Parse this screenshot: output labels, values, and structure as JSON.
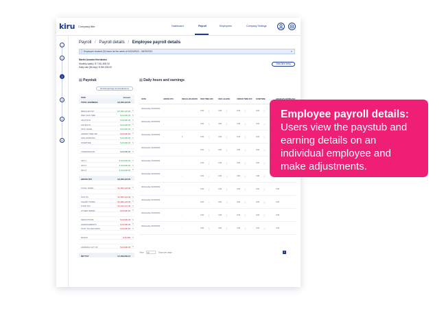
{
  "app": {
    "logo": "kiru",
    "company": "Company title"
  },
  "nav": {
    "items": [
      "Dashboard",
      "Payroll",
      "Employees",
      "Company Settings"
    ]
  },
  "header_icons": [
    "user-icon",
    "settings-icon"
  ],
  "steps": [
    "‹",
    "1",
    "2",
    "3",
    "4",
    "5"
  ],
  "breadcrumb": {
    "a": "Payroll",
    "b": "Payroll details",
    "current": "Employee payroll details",
    "sep": "/"
  },
  "alert": {
    "text": "Employee clocked (9) hours for the week of 04/24/2022 - 04/23/2021",
    "close": "×"
  },
  "employee": {
    "name": "Martin Amador Hernández",
    "salary": "Monthly salary: $ 7,511,600.00",
    "rate": "Daily rate (8h day): $ 250,000.00"
  },
  "view_button": "View time entry",
  "paystub": {
    "title": "Paystub",
    "add_button": "⊕ Add earnings and deductions",
    "header": {
      "item": "ITEM",
      "amount": "Amount"
    },
    "rows": [
      {
        "l": "TOTAL EARNINGS",
        "v": "$ 6,350,124.00",
        "t": "total",
        "c": ""
      },
      {
        "l": "",
        "v": "",
        "t": "",
        "c": ""
      },
      {
        "l": "REGULAR PAY",
        "v": "$ 4,960,124.00",
        "t": "",
        "c": "g"
      },
      {
        "l": "PAID SICK TIME",
        "v": "$ 20,000.00",
        "t": "",
        "c": "g"
      },
      {
        "l": "VACATION",
        "v": "$ 20,000.00",
        "t": "",
        "c": "g"
      },
      {
        "l": "HOLIDAYS",
        "v": "$ 20,000.00",
        "t": "",
        "c": "g"
      },
      {
        "l": "SICK LEAVE",
        "v": "$ 20,000.00",
        "t": "",
        "c": "g"
      },
      {
        "l": "UNPAID TIME OFF",
        "v": "$ 20,000.00",
        "t": "",
        "c": "r"
      },
      {
        "l": "NON-WORKING",
        "v": "$ 20,000.00",
        "t": "",
        "c": "g"
      },
      {
        "l": "OVERTIME",
        "v": "$ 20,000.00",
        "t": "",
        "c": "g"
      },
      {
        "l": "",
        "v": "",
        "t": "",
        "c": ""
      },
      {
        "l": "COMMISSIONS",
        "v": "$ 20,000.00",
        "t": "",
        "c": ""
      },
      {
        "l": "",
        "v": "",
        "t": "",
        "c": ""
      },
      {
        "l": "SKU 1",
        "v": "$ 100,000.00",
        "t": "",
        "c": "g"
      },
      {
        "l": "SKU 2",
        "v": "$ 100,000.00",
        "t": "",
        "c": "g"
      },
      {
        "l": "SKU 3",
        "v": "$ 100,000.00",
        "t": "",
        "c": "g"
      },
      {
        "l": "",
        "v": "",
        "t": "",
        "c": ""
      },
      {
        "l": "GROSS PAY",
        "v": "$ 6,350,124.00",
        "t": "total",
        "c": ""
      },
      {
        "l": "",
        "v": "",
        "t": "",
        "c": ""
      },
      {
        "l": "TOTAL TAXES",
        "v": "$ 1,660,124.00",
        "t": "",
        "c": "r"
      },
      {
        "l": "",
        "v": "",
        "t": "",
        "c": ""
      },
      {
        "l": "FICA SS",
        "v": "$ 4,960,124.00",
        "t": "",
        "c": "r"
      },
      {
        "l": "SALARY TAXES",
        "v": "$ 4,960,124.00",
        "t": "",
        "c": "r"
      },
      {
        "l": "FUND TAX",
        "v": "$ 3,613,137.00",
        "t": "",
        "c": "r"
      },
      {
        "l": "OTHER TERMS",
        "v": "$ 20,000.00",
        "t": "",
        "c": "r"
      },
      {
        "l": "",
        "v": "",
        "t": "",
        "c": ""
      },
      {
        "l": "DEDUCTIONS",
        "v": "$ 20,000.00",
        "t": "",
        "c": "r"
      },
      {
        "l": "GARNISHMENTS",
        "v": "$ 20,000.00",
        "t": "",
        "c": "r"
      },
      {
        "l": "POST TAX RETURNS",
        "v": "$ 20,000.00",
        "t": "",
        "c": "r"
      },
      {
        "l": "",
        "v": "",
        "t": "",
        "c": ""
      },
      {
        "l": "BANUS",
        "v": "$ 20,000",
        "t": "",
        "c": "r"
      },
      {
        "l": "",
        "v": "",
        "t": "",
        "c": ""
      },
      {
        "l": "ADVANCE CUT OF",
        "v": "$ 20,000.00",
        "t": "",
        "c": "r"
      },
      {
        "l": "",
        "v": "",
        "t": "",
        "c": ""
      },
      {
        "l": "NET PAY",
        "v": "$ 4,639,262.13",
        "t": "total",
        "c": ""
      }
    ]
  },
  "daily": {
    "title": "Daily hours and earnings",
    "columns": [
      "DATE",
      "GROSS PAY",
      "REGULAR HOURS",
      "PAID TIME OFF",
      "SICK LEAVES",
      "UNPAID TIME OFF",
      "OVERTIME",
      "HOLIDAYS EXTRA PAY"
    ],
    "rows": [
      {
        "date": "Wednesday 04/06/2021",
        "gross": "-",
        "reg": "-",
        "pto": "0.00",
        "sick": "0.00",
        "unpaid": "0.00",
        "ot": "0.00",
        "hol": ""
      },
      {
        "date": "Wednesday 04/06/2021",
        "gross": "-",
        "reg": "-",
        "pto": "0.00",
        "sick": "0.00",
        "unpaid": "0.00",
        "ot": "0.00",
        "hol": ""
      },
      {
        "date": "Wednesday 04/06/2021",
        "gross": "-",
        "reg": "1",
        "pto": "0.00",
        "sick": "0.00",
        "unpaid": "0.00",
        "ot": "0.00",
        "hol": ""
      },
      {
        "date": "Wednesday 04/06/2021",
        "gross": "-",
        "reg": "-",
        "pto": "0.00",
        "sick": "0.00",
        "unpaid": "0.00",
        "ot": "0.00",
        "hol": ""
      },
      {
        "date": "Wednesday 04/06/2021",
        "gross": "-",
        "reg": "-",
        "pto": "0.00",
        "sick": "0.00",
        "unpaid": "0.00",
        "ot": "0.00",
        "hol": ""
      },
      {
        "date": "Wednesday 04/06/2021",
        "gross": "-",
        "reg": "-",
        "pto": "0.00",
        "sick": "0.00",
        "unpaid": "0.00",
        "ot": "0.00",
        "hol": "0.00"
      },
      {
        "date": "Wednesday 04/06/2021",
        "gross": "-",
        "reg": "-",
        "pto": "0.00",
        "sick": "0.00",
        "unpaid": "0.00",
        "ot": "0.00",
        "hol": "0.00"
      },
      {
        "date": "Wednesday 04/06/2021",
        "gross": "-",
        "reg": "-",
        "pto": "0.00",
        "sick": "0.00",
        "unpaid": "0.00",
        "ot": "0.00",
        "hol": "0.00"
      },
      {
        "date": "Wednesday 04/06/2021",
        "gross": "-",
        "reg": "-",
        "pto": "0.00",
        "sick": "0.00",
        "unpaid": "0.00",
        "ot": "0.00",
        "hol": "0.00"
      },
      {
        "date": "Wednesday 04/06/2021",
        "gross": "-",
        "reg": "-",
        "pto": "0.00",
        "sick": "0.00",
        "unpaid": "0.00",
        "ot": "0.00",
        "hol": "0.00"
      }
    ],
    "pager": {
      "view": "View",
      "per_page_value": "10",
      "per_page_label": "Days per page",
      "prev": "‹",
      "current": "1",
      "next": "›"
    }
  },
  "callout": {
    "title": "Employee payroll details:",
    "body": "Users view the paystub and earning details on an individual employee and make adjustments."
  },
  "colors": {
    "accent": "#1b3b8f",
    "callout": "#ef1f76",
    "positive": "#1f9a3a",
    "negative": "#d0202c"
  }
}
